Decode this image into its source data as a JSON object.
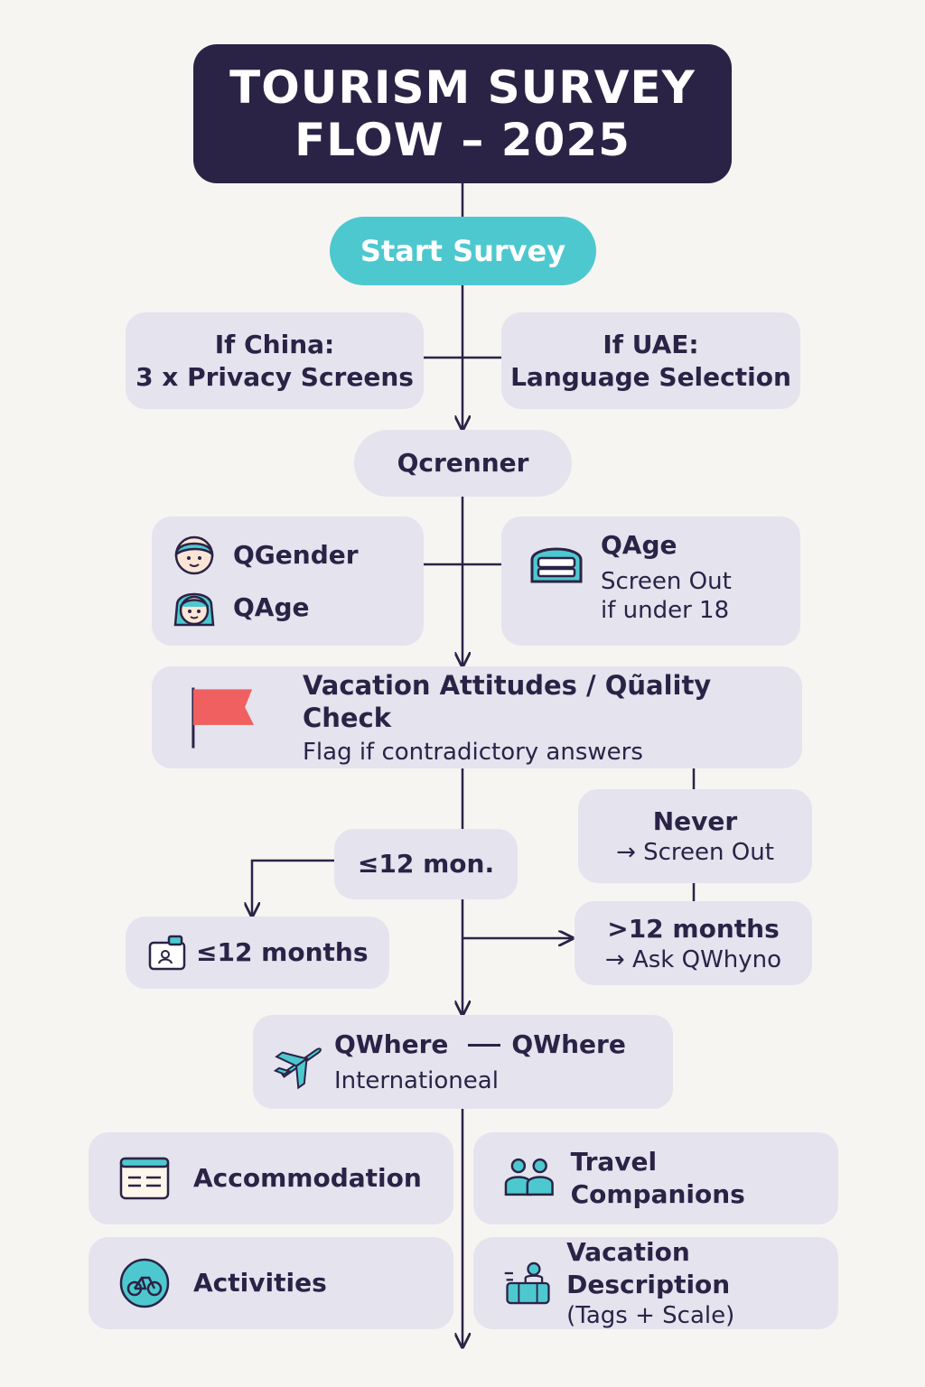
{
  "diagram": {
    "title_line1": "TOURISM SURVEY",
    "title_line2": "FLOW – 2025",
    "start": "Start Survey",
    "china": {
      "line1": "If China:",
      "line2": "3 x Privacy Screens"
    },
    "uae": {
      "line1": "If UAE:",
      "line2": "Language Selection"
    },
    "screener": "Qcrenner",
    "demographics": {
      "gender": "QGender",
      "age": "QAge"
    },
    "age_check": {
      "title": "QAge",
      "line1": "Screen Out",
      "line2": "if under 18"
    },
    "quality": {
      "title": "Vacation Attitudes / Qũality Check",
      "subtitle": "Flag if contradictory answers"
    },
    "le12_mon": "≤12 mon.",
    "never": {
      "title": "Never",
      "action": "→ Screen Out"
    },
    "le12_months": "≤12 months",
    "gt12": {
      "title": ">12 months",
      "action": "→ Ask QWhyno"
    },
    "where": {
      "left": "QWhere",
      "right": "QWhere",
      "sub": "Internationeal"
    },
    "accommodation": "Accommodation",
    "companions": "Travel Companions",
    "activities": "Activities",
    "vacation_description": {
      "title": "Vacation Description",
      "sub": "(Tags + Scale)"
    }
  },
  "colors": {
    "dark": "#2b2346",
    "teal": "#4ec8cf",
    "node": "#e4e3ee",
    "flag": "#f06060",
    "background": "#f7f5f2"
  },
  "icons": [
    "person-icon",
    "bed-icon",
    "flag-icon",
    "id-card-icon",
    "airplane-icon",
    "hotel-card-icon",
    "group-icon",
    "bicycle-icon",
    "luggage-icon"
  ]
}
